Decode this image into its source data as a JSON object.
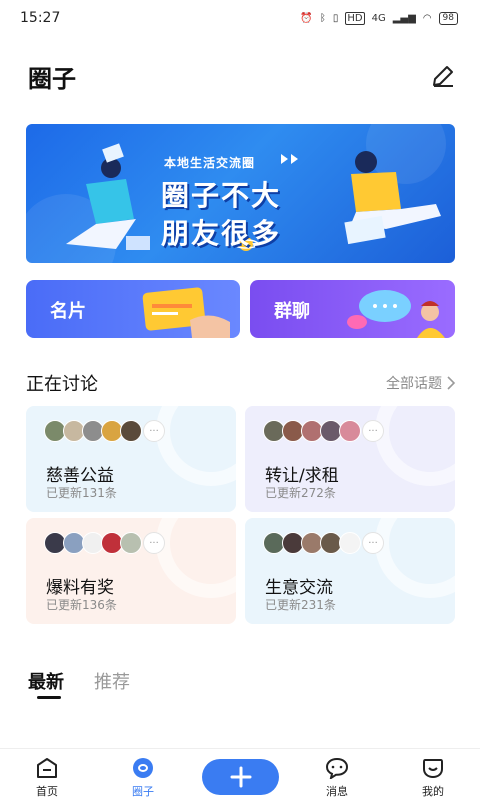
{
  "status_bar": {
    "time": "15:27",
    "battery": "98",
    "network": "4G"
  },
  "header": {
    "title": "圈子"
  },
  "banner": {
    "subtitle": "本地生活交流圈",
    "line1": "圈子不大",
    "line2": "朋友很多"
  },
  "quick_entries": [
    {
      "label": "名片"
    },
    {
      "label": "群聊"
    }
  ],
  "discussion": {
    "title": "正在讨论",
    "all_link": "全部话题",
    "topics": [
      {
        "name": "慈善公益",
        "updates": "已更新131条",
        "avatar_colors": [
          "#7b8a6a",
          "#c7b8a0",
          "#8d8d8d",
          "#d9a441",
          "#5a4a3a"
        ]
      },
      {
        "name": "转让/求租",
        "updates": "已更新272条",
        "avatar_colors": [
          "#6a6a5a",
          "#8a5a4a",
          "#b07070",
          "#6a5a6a",
          "#d88a9a"
        ]
      },
      {
        "name": "爆料有奖",
        "updates": "已更新136条",
        "avatar_colors": [
          "#3a3a4a",
          "#8aa0c0",
          "#f0f0f0",
          "#c0303a",
          "#b8c0b0"
        ]
      },
      {
        "name": "生意交流",
        "updates": "已更新231条",
        "avatar_colors": [
          "#5a6a5a",
          "#4a3a3a",
          "#9a7a6a",
          "#6a5a4a",
          "#f4f4f4"
        ]
      }
    ]
  },
  "feed_tabs": [
    {
      "label": "最新",
      "active": true
    },
    {
      "label": "推荐",
      "active": false
    }
  ],
  "bottom_nav": {
    "items": [
      {
        "label": "首页",
        "icon": "home-icon"
      },
      {
        "label": "圈子",
        "icon": "circle-icon",
        "active": true
      },
      {
        "label": "消息",
        "icon": "message-icon"
      },
      {
        "label": "我的",
        "icon": "profile-icon"
      }
    ],
    "accent": "#3a7cf2"
  }
}
